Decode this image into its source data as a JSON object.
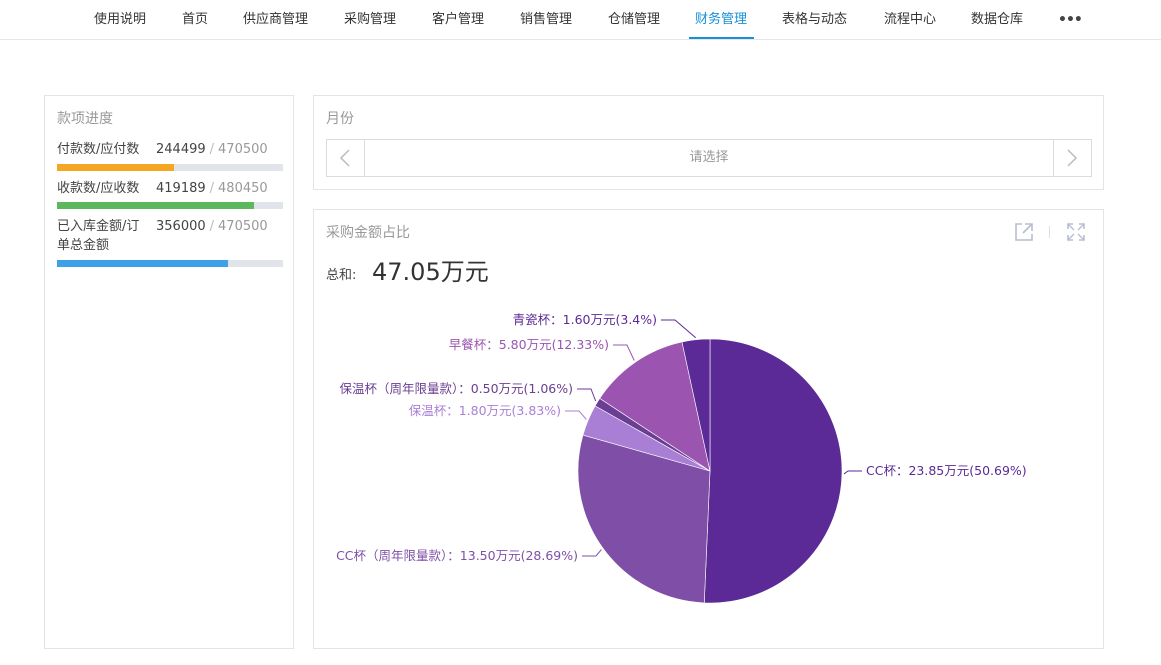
{
  "nav": {
    "items": [
      {
        "label": "使用说明"
      },
      {
        "label": "首页"
      },
      {
        "label": "供应商管理"
      },
      {
        "label": "采购管理"
      },
      {
        "label": "客户管理"
      },
      {
        "label": "销售管理"
      },
      {
        "label": "仓储管理"
      },
      {
        "label": "财务管理"
      },
      {
        "label": "表格与动态"
      },
      {
        "label": "流程中心"
      },
      {
        "label": "数据仓库"
      }
    ],
    "active": "财务管理",
    "more_label": "•••"
  },
  "progress": {
    "title": "款项进度",
    "items": [
      {
        "label": "付款数/应付数",
        "value": "244499",
        "total": "470500",
        "color": "#f5a623"
      },
      {
        "label": "收款数/应收数",
        "value": "419189",
        "total": "480450",
        "color": "#5cb85c"
      },
      {
        "label": "已入库金额/订单总金额",
        "value": "356000",
        "total": "470500",
        "color": "#3ea1e8"
      }
    ],
    "separator": "/"
  },
  "month": {
    "title": "月份",
    "placeholder": "请选择"
  },
  "chart_panel": {
    "title": "采购金额占比",
    "sum_label": "总和:",
    "sum_value": "47.05万元"
  },
  "chart_data": {
    "type": "pie",
    "unit": "万元",
    "slices": [
      {
        "name": "CC杯",
        "value": 23.85,
        "percent": 50.69,
        "label": "CC杯：23.85万元(50.69%)",
        "color": "#5b2a96"
      },
      {
        "name": "CC杯（周年限量款）",
        "value": 13.5,
        "percent": 28.69,
        "label": "CC杯（周年限量款）：13.50万元(28.69%)",
        "color": "#7f4fa8"
      },
      {
        "name": "保温杯",
        "value": 1.8,
        "percent": 3.83,
        "label": "保温杯：1.80万元(3.83%)",
        "color": "#a97fd6"
      },
      {
        "name": "保温杯（周年限量款）",
        "value": 0.5,
        "percent": 1.06,
        "label": "保温杯（周年限量款）：0.50万元(1.06%)",
        "color": "#6a3e93"
      },
      {
        "name": "早餐杯",
        "value": 5.8,
        "percent": 12.33,
        "label": "早餐杯：5.80万元(12.33%)",
        "color": "#9b55b0"
      },
      {
        "name": "青瓷杯",
        "value": 1.6,
        "percent": 3.4,
        "label": "青瓷杯：1.60万元(3.4%)",
        "color": "#5b2a96"
      }
    ]
  }
}
